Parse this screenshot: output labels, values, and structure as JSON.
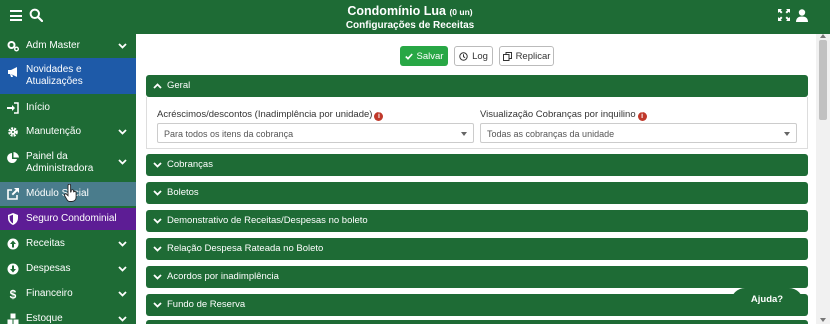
{
  "header": {
    "title": "Condomínio Lua",
    "title_suffix": "(0 un)",
    "subtitle": "Configurações de Receitas",
    "icons": [
      "menu-icon",
      "search-icon",
      "expand-icon",
      "user-icon"
    ]
  },
  "sidebar": {
    "items": [
      {
        "label": "Adm Master",
        "icon": "gears-icon",
        "chevron": true
      },
      {
        "label": "Novidades e Atualizações",
        "icon": "megaphone-icon",
        "chevron": false
      },
      {
        "label": "Início",
        "icon": "sign-in-icon",
        "chevron": false
      },
      {
        "label": "Manutenção",
        "icon": "gear-icon",
        "chevron": true
      },
      {
        "label": "Painel da Administradora",
        "icon": "pie-chart-icon",
        "chevron": true
      },
      {
        "label": "Módulo Social",
        "icon": "external-link-icon",
        "chevron": false
      },
      {
        "label": "Seguro Condominial",
        "icon": "shield-icon",
        "chevron": false
      },
      {
        "label": "Receitas",
        "icon": "arrow-circle-up-icon",
        "chevron": true
      },
      {
        "label": "Despesas",
        "icon": "arrow-circle-down-icon",
        "chevron": true
      },
      {
        "label": "Financeiro",
        "icon": "dollar-icon",
        "chevron": true
      },
      {
        "label": "Estoque",
        "icon": "cubes-icon",
        "chevron": true
      }
    ]
  },
  "toolbar": {
    "save_label": "Salvar",
    "log_label": "Log",
    "replicate_label": "Replicar"
  },
  "geral": {
    "title": "Geral",
    "field1_label": "Acréscimos/descontos (Inadimplência por unidade)",
    "field1_value": "Para todos os itens da cobrança",
    "field2_label": "Visualização Cobranças por inquilino",
    "field2_value": "Todas as cobranças da unidade"
  },
  "sections": [
    "Cobranças",
    "Boletos",
    "Demonstrativo de Receitas/Despesas no boleto",
    "Relação Despesa Rateada no Boleto",
    "Acordos por inadimplência",
    "Fundo de Reserva"
  ],
  "help_label": "Ajuda?",
  "colors": {
    "primary_green": "#1e6b35",
    "save_green": "#28a745",
    "active_blue": "#1e5aa8",
    "purple": "#5d1d95",
    "info_red": "#c0392b"
  }
}
